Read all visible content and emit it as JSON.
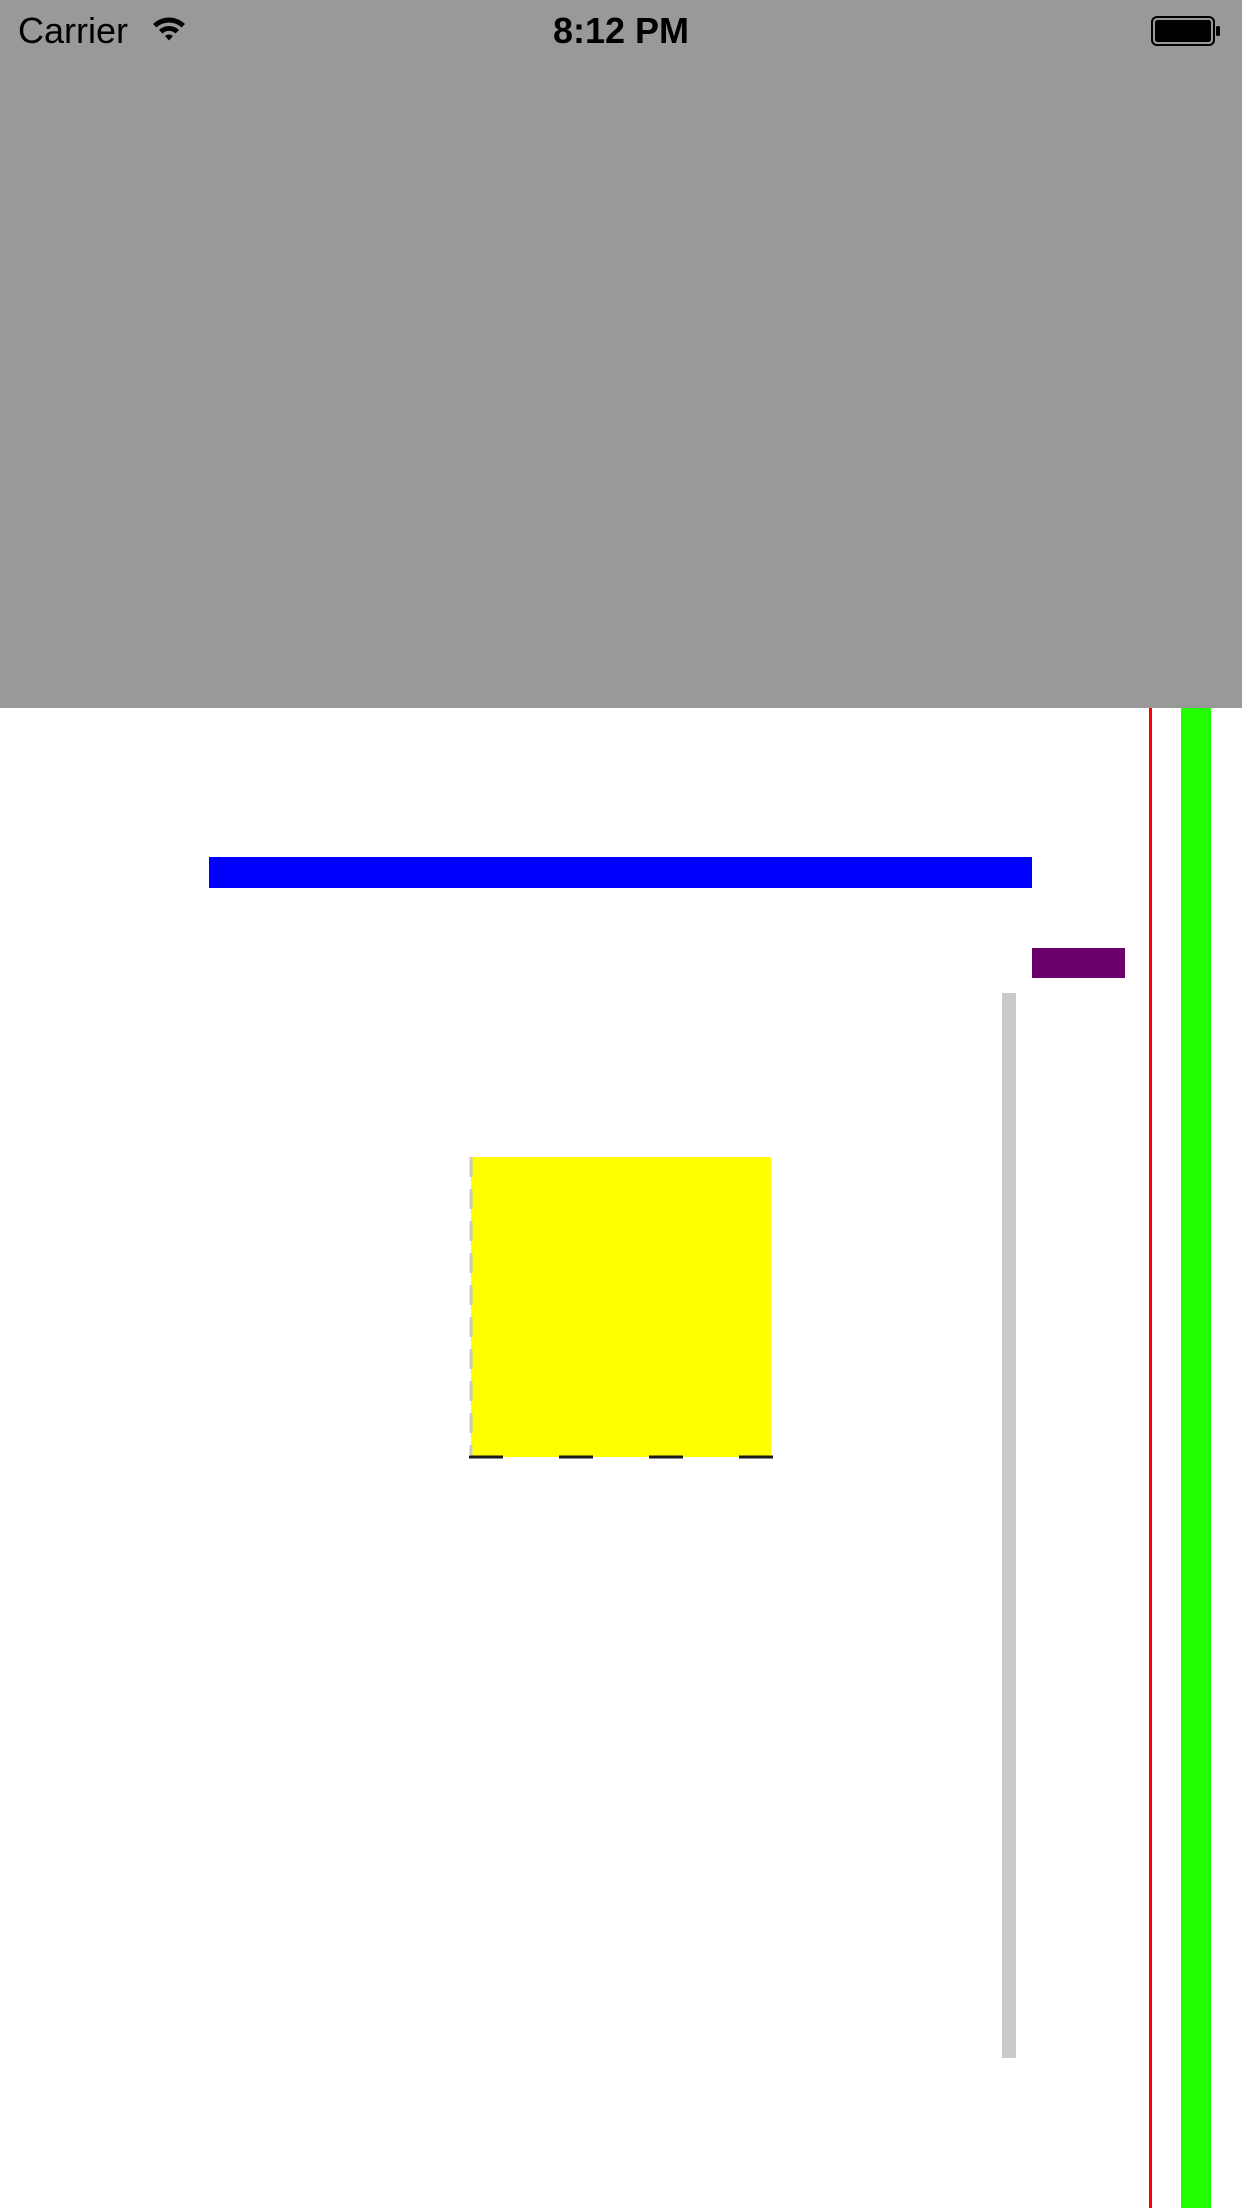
{
  "status_bar": {
    "carrier": "Carrier",
    "time": "8:12 PM",
    "wifi_icon": "wifi-icon",
    "battery_icon": "battery-full-icon"
  },
  "colors": {
    "top_panel": "#999999",
    "background": "#ffffff",
    "blue_bar": "#0000ff",
    "purple_bar": "#6b006b",
    "yellow_box": "#ffff00",
    "gray_track": "#cacaca",
    "red_line": "#ff0000",
    "green_bar": "#22ff00"
  }
}
